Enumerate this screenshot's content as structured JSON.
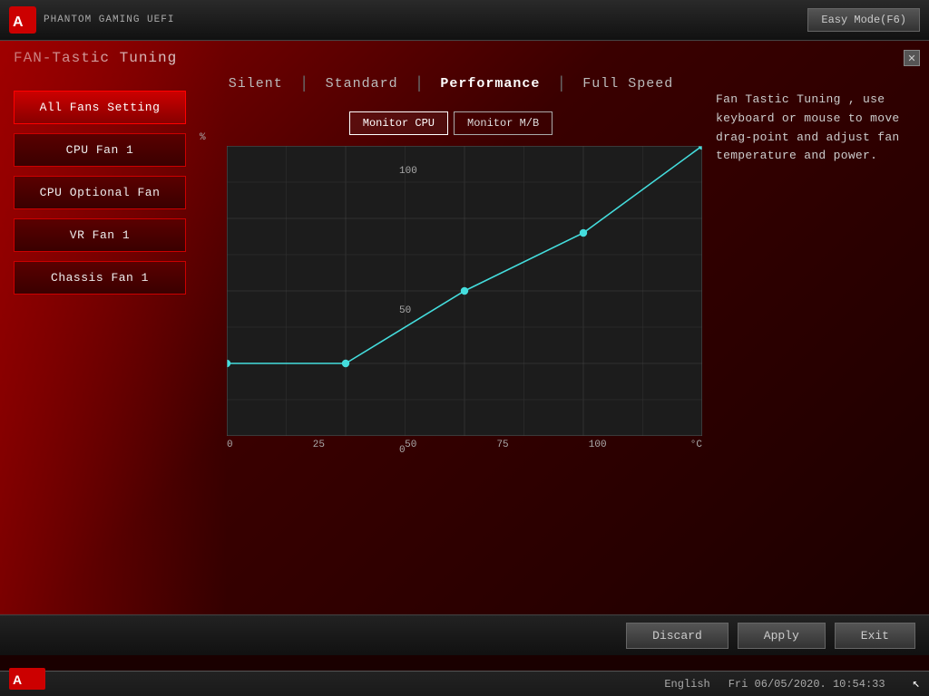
{
  "header": {
    "easy_mode_label": "Easy Mode(F6)",
    "logo_text": "PHANTOM GAMING UEFI"
  },
  "page": {
    "title": "FAN-Tastic Tuning",
    "close_icon": "✕"
  },
  "sidebar": {
    "items": [
      {
        "id": "all-fans",
        "label": "All Fans Setting",
        "active": true
      },
      {
        "id": "cpu-fan-1",
        "label": "CPU Fan 1",
        "active": false
      },
      {
        "id": "cpu-optional",
        "label": "CPU Optional Fan",
        "active": false
      },
      {
        "id": "vr-fan-1",
        "label": "VR Fan 1",
        "active": false
      },
      {
        "id": "chassis-fan-1",
        "label": "Chassis Fan 1",
        "active": false
      }
    ]
  },
  "tabs": [
    {
      "id": "silent",
      "label": "Silent",
      "active": false
    },
    {
      "id": "standard",
      "label": "Standard",
      "active": false
    },
    {
      "id": "performance",
      "label": "Performance",
      "active": true
    },
    {
      "id": "full-speed",
      "label": "Full Speed",
      "active": false
    }
  ],
  "monitor": {
    "cpu_label": "Monitor CPU",
    "mb_label": "Monitor M/B"
  },
  "chart": {
    "y_label": "%",
    "x_label": "°C",
    "y_ticks": [
      100,
      50,
      0
    ],
    "x_ticks": [
      0,
      25,
      50,
      75,
      100
    ],
    "line_color": "#4dd",
    "grid_color": "#444",
    "bg_color": "#1c1c1c",
    "points": [
      [
        0,
        25
      ],
      [
        25,
        25
      ],
      [
        50,
        50
      ],
      [
        75,
        70
      ],
      [
        100,
        100
      ]
    ]
  },
  "info_text": "Fan Tastic Tuning , use keyboard or mouse to move drag-point and adjust fan temperature and power.",
  "footer": {
    "discard_label": "Discard",
    "apply_label": "Apply",
    "exit_label": "Exit"
  },
  "statusbar": {
    "language": "English",
    "datetime": "Fri 06/05/2020. 10:54:33"
  }
}
